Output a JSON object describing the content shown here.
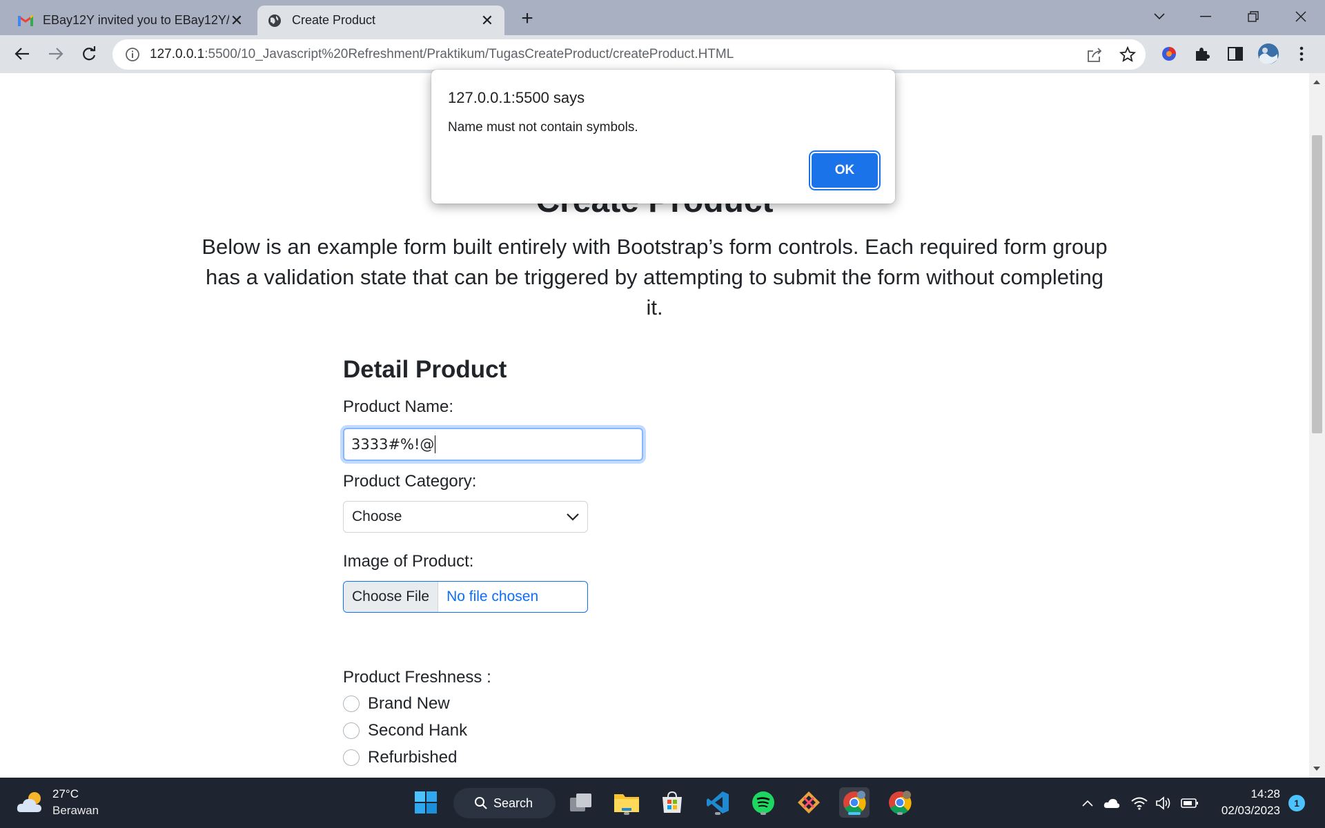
{
  "browser": {
    "tabs": [
      {
        "title": "EBay12Y invited you to EBay12Y/",
        "icon": "gmail-icon"
      },
      {
        "title": "Create Product",
        "icon": "globe-icon"
      }
    ],
    "url_host": "127.0.0.1",
    "url_path": ":5500/10_Javascript%20Refreshment/Praktikum/TugasCreateProduct/createProduct.HTML"
  },
  "page": {
    "title": "Create Product",
    "lead": "Below is an example form built entirely with Bootstrap’s form controls. Each required form group has a validation state that can be triggered by attempting to submit the form without completing it.",
    "form": {
      "section_title": "Detail Product",
      "name_label": "Product Name:",
      "name_value": "3333#%!@",
      "category_label": "Product Category:",
      "category_value": "Choose",
      "image_label": "Image of Product:",
      "file_button": "Choose File",
      "file_status": "No file chosen",
      "freshness_label": "Product Freshness :",
      "freshness_options": [
        "Brand New",
        "Second Hank",
        "Refurbished"
      ]
    }
  },
  "dialog": {
    "title": "127.0.0.1:5500 says",
    "message": "Name must not contain symbols.",
    "ok_label": "OK"
  },
  "taskbar": {
    "weather_temp": "27°C",
    "weather_desc": "Berawan",
    "search_label": "Search",
    "time": "14:28",
    "date": "02/03/2023",
    "notification_count": "1"
  },
  "colors": {
    "primary": "#0d6efd",
    "dialog_button": "#1a73e8",
    "tabbar": "#a9b0c1",
    "toolbar": "#dee1e6",
    "taskbar": "#1f2530"
  }
}
